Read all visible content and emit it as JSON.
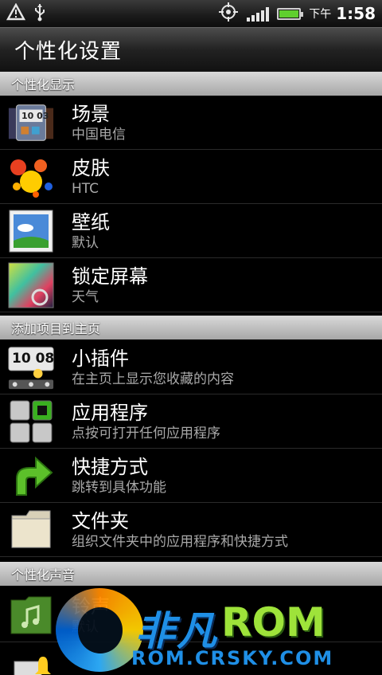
{
  "status_bar": {
    "ampm": "下午",
    "time": "1:58",
    "battery_level": 1.0,
    "icons": [
      "alert-triangle-icon",
      "usb-icon",
      "gps-icon",
      "signal-icon",
      "battery-icon"
    ]
  },
  "title": "个性化设置",
  "sections": {
    "display": "个性化显示",
    "add_home": "添加项目到主页",
    "sound": "个性化声音"
  },
  "items": {
    "scene": {
      "title": "场景",
      "subtitle": "中国电信",
      "icon_label": "10 03"
    },
    "skin": {
      "title": "皮肤",
      "subtitle": "HTC"
    },
    "wallpaper": {
      "title": "壁纸",
      "subtitle": "默认"
    },
    "lockscreen": {
      "title": "锁定屏幕",
      "subtitle": "天气"
    },
    "widget": {
      "title": "小插件",
      "subtitle": "在主页上显示您收藏的内容",
      "icon_label": "10 08"
    },
    "apps": {
      "title": "应用程序",
      "subtitle": "点按可打开任何应用程序"
    },
    "shortcut": {
      "title": "快捷方式",
      "subtitle": "跳转到具体功能"
    },
    "folder": {
      "title": "文件夹",
      "subtitle": "组织文件夹中的应用程序和快捷方式"
    },
    "ringtone": {
      "title": "铃声",
      "subtitle": "默认"
    }
  },
  "watermark": {
    "brand": "非凡",
    "rom": "ROM",
    "url": "ROM.CRSKY.COM"
  },
  "colors": {
    "section_header": "#bdbdbd",
    "subtitle": "#a9a9a9",
    "accent_green": "#5fcf2e",
    "watermark_blue": "#1f8fe6"
  }
}
